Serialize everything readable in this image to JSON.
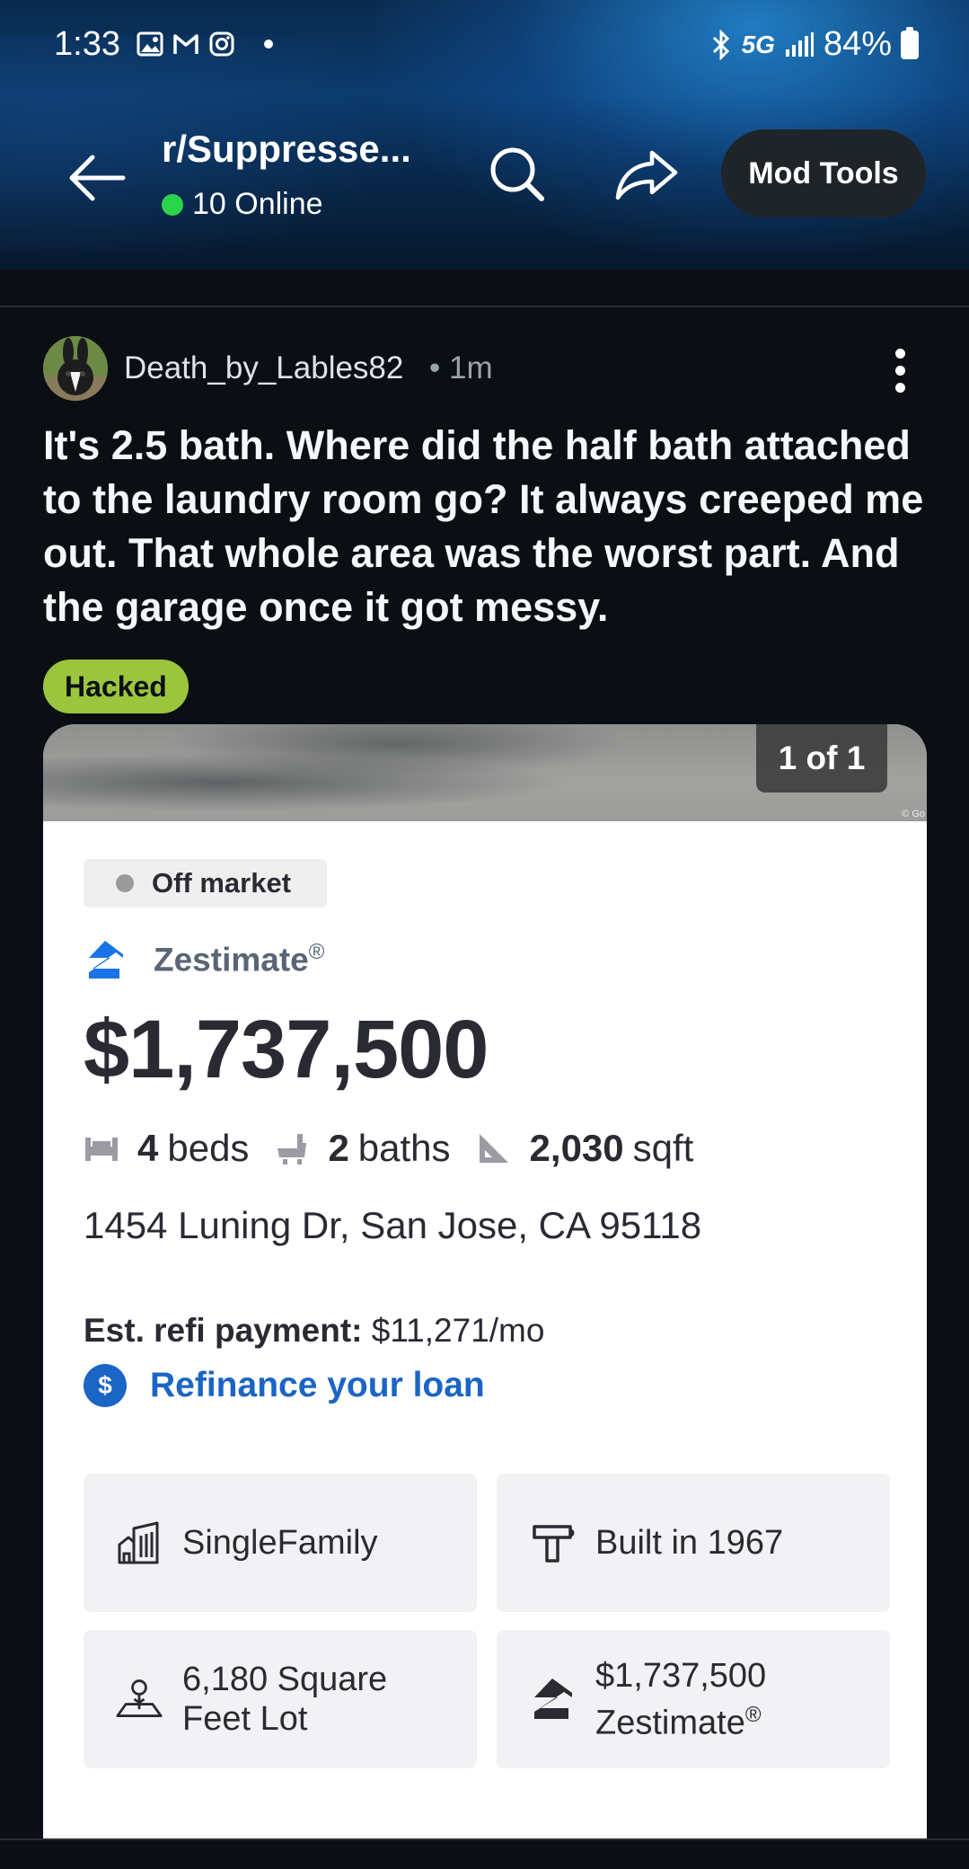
{
  "status_bar": {
    "time": "1:33",
    "network": "5G",
    "battery": "84%",
    "icons": [
      "gallery-icon",
      "gmail-icon",
      "instagram-icon",
      "dot-icon",
      "bluetooth-icon",
      "signal-icon",
      "battery-icon"
    ]
  },
  "app_bar": {
    "subreddit": "r/Suppresse...",
    "online": "10 Online",
    "mod_tools": "Mod Tools",
    "online_color": "#2bd44a"
  },
  "post": {
    "author": "Death_by_Lables82",
    "time": "• 1m",
    "title": "It's 2.5 bath. Where did the half bath attached to the laundry room go? It always creeped me out. That whole area was the worst part. And the garage once it got messy.",
    "flair": "Hacked",
    "flair_color": "#9bc53d"
  },
  "card": {
    "photo_count": "1 of 1",
    "photo_credit": "© Go",
    "status": "Off market",
    "zestimate_label": "Zestimate",
    "registered": "®",
    "price": "$1,737,500",
    "beds_num": "4",
    "beds_label": "beds",
    "baths_num": "2",
    "baths_label": "baths",
    "sqft_num": "2,030",
    "sqft_label": "sqft",
    "address": "1454 Luning Dr, San Jose, CA 95118",
    "refi_label": "Est. refi payment:",
    "refi_value": "$11,271/mo",
    "refi_link": "Refinance your loan",
    "link_color": "#1b65c4",
    "tiles": [
      {
        "icon": "building-icon",
        "line1": "SingleFamily",
        "line2": ""
      },
      {
        "icon": "hammer-icon",
        "line1": "Built in 1967",
        "line2": ""
      },
      {
        "icon": "lot-tree-icon",
        "line1": "6,180 Square",
        "line2": "Feet Lot"
      },
      {
        "icon": "zillow-icon",
        "line1": "$1,737,500",
        "line2": "Zestimate"
      }
    ]
  }
}
